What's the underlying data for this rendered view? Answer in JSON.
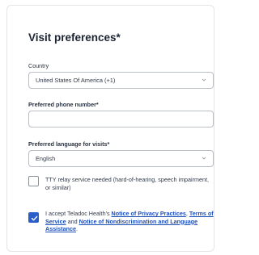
{
  "form": {
    "title": "Visit preferences*",
    "country": {
      "label": "Country",
      "value": "United States Of America (+1)"
    },
    "phone": {
      "label": "Preferred phone number*",
      "value": ""
    },
    "language": {
      "label": "Preferred language for visits*",
      "value": "English"
    },
    "tty": {
      "label": "TTY relay service needed (hard-of-hearing, speech impairment, or similar)",
      "checked": false
    },
    "consent": {
      "checked": true,
      "prefix": "I accept Teladoc Health's ",
      "link_privacy": "Notice of Privacy Practices",
      "sep1": ", ",
      "link_terms": "Terms of Service",
      "sep2": " and ",
      "link_nondiscrimination": "Notice of Nondiscrimination and Language Assistance",
      "suffix": "."
    }
  },
  "colors": {
    "accent": "#2b5ec8",
    "link": "#1d4fb8",
    "border": "#b9bec7"
  },
  "icons": {
    "select": "chevron-down-icon",
    "check": "checkmark-icon"
  }
}
